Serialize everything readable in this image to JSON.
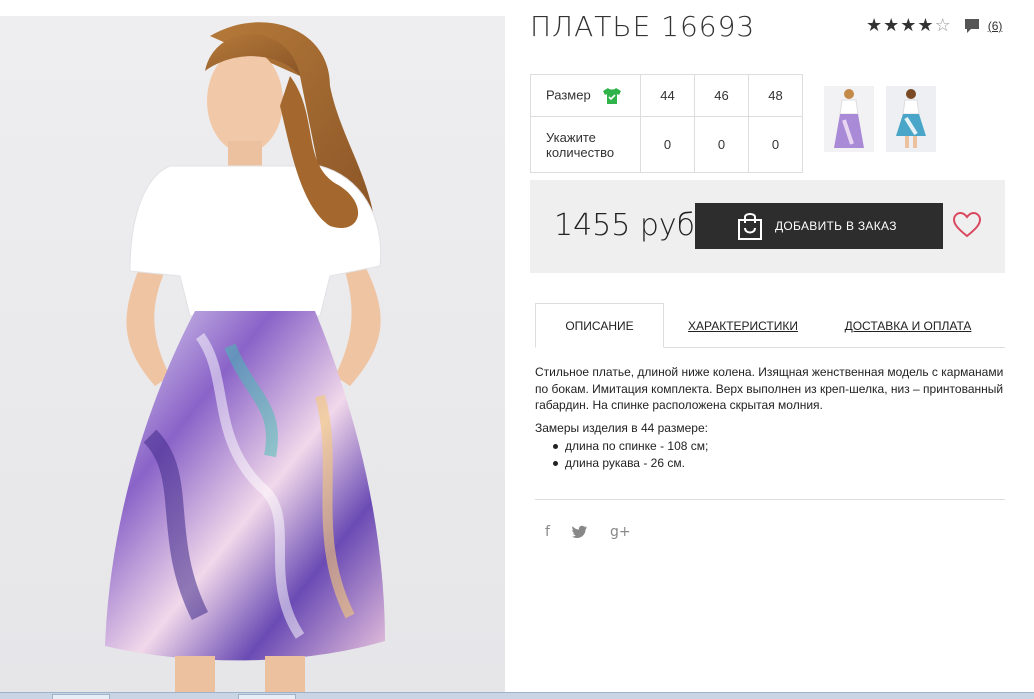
{
  "product": {
    "title": "ПЛАТЬЕ 16693",
    "rating": 4,
    "rating_max": 5,
    "review_count": "(6)"
  },
  "sizes": {
    "size_label": "Размер",
    "qty_label_line1": "Укажите",
    "qty_label_line2": "количество",
    "options": [
      "44",
      "46",
      "48"
    ],
    "quantities": [
      "0",
      "0",
      "0"
    ]
  },
  "price": {
    "value": "1455 руб",
    "add_button": "ДОБАВИТЬ В ЗАКАЗ"
  },
  "tabs": [
    {
      "label": "ОПИСАНИЕ",
      "active": true
    },
    {
      "label": "ХАРАКТЕРИСТИКИ",
      "active": false
    },
    {
      "label": "ДОСТАВКА И ОПЛАТА",
      "active": false
    }
  ],
  "description": {
    "text": "Стильное платье, длиной ниже колена. Изящная женственная модель с карманами по бокам. Имитация комплекта. Верх выполнен из креп-шелка, низ – принтованный габардин. На спинке расположена скрытая молния.",
    "sizes_heading": "Замеры изделия в 44 размере:",
    "measurements": [
      "длина по спинке - 108 см;",
      "длина рукава - 26 см."
    ]
  },
  "social": {
    "facebook": "f",
    "twitter": "twitter-icon",
    "google_plus": "g+"
  },
  "colors": {
    "button_bg": "#2d2d2d",
    "panel_bg": "#efefef",
    "heart": "#d9485f",
    "shirt_icon": "#2fb34a"
  }
}
